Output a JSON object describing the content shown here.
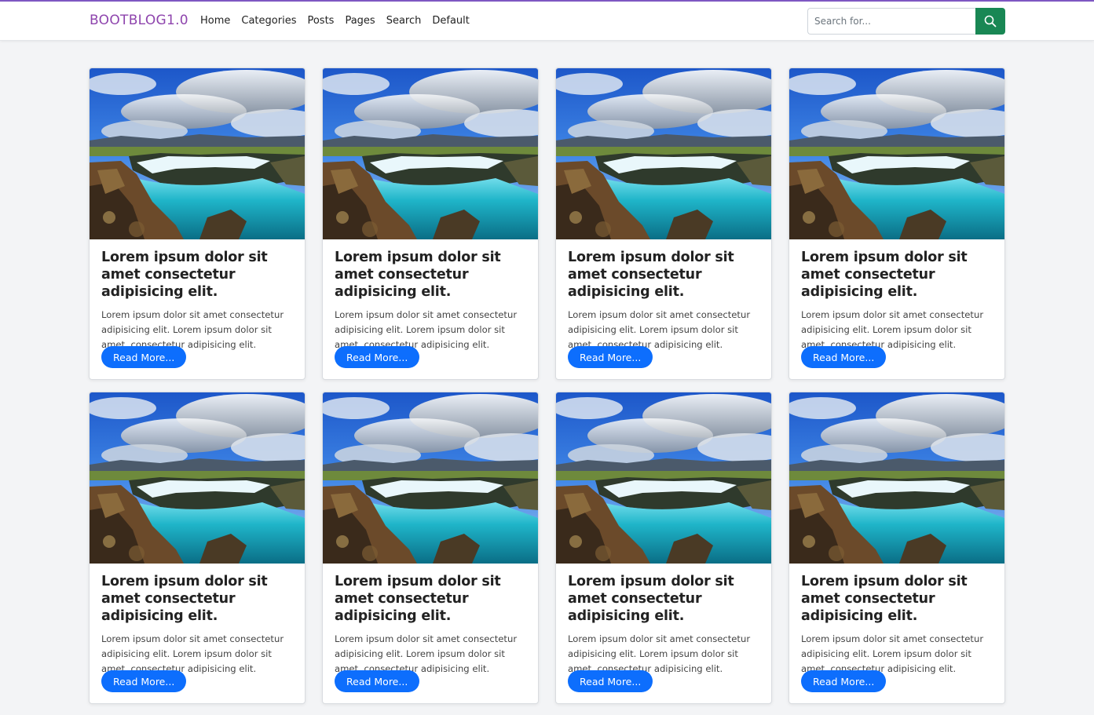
{
  "navbar": {
    "brand": "BOOTBLOG1.0",
    "links": [
      "Home",
      "Categories",
      "Posts",
      "Pages",
      "Search",
      "Default"
    ],
    "search_placeholder": "Search for...",
    "search_icon": "search-icon"
  },
  "colors": {
    "brand": "#8e44ad",
    "top_accent": "#7e57c2",
    "search_button": "#198754",
    "read_more": "#0d6efd"
  },
  "cards": [
    {
      "title": "Lorem ipsum dolor sit amet consectetur adipisicing elit.",
      "text": "Lorem ipsum dolor sit amet consectetur adipisicing elit. Lorem ipsum dolor sit amet, consectetur adipisicing elit.",
      "button": "Read More..."
    },
    {
      "title": "Lorem ipsum dolor sit amet consectetur adipisicing elit.",
      "text": "Lorem ipsum dolor sit amet consectetur adipisicing elit. Lorem ipsum dolor sit amet, consectetur adipisicing elit.",
      "button": "Read More..."
    },
    {
      "title": "Lorem ipsum dolor sit amet consectetur adipisicing elit.",
      "text": "Lorem ipsum dolor sit amet consectetur adipisicing elit. Lorem ipsum dolor sit amet, consectetur adipisicing elit.",
      "button": "Read More..."
    },
    {
      "title": "Lorem ipsum dolor sit amet consectetur adipisicing elit.",
      "text": "Lorem ipsum dolor sit amet consectetur adipisicing elit. Lorem ipsum dolor sit amet, consectetur adipisicing elit.",
      "button": "Read More..."
    },
    {
      "title": "Lorem ipsum dolor sit amet consectetur adipisicing elit.",
      "text": "Lorem ipsum dolor sit amet consectetur adipisicing elit. Lorem ipsum dolor sit amet, consectetur adipisicing elit.",
      "button": "Read More..."
    },
    {
      "title": "Lorem ipsum dolor sit amet consectetur adipisicing elit.",
      "text": "Lorem ipsum dolor sit amet consectetur adipisicing elit. Lorem ipsum dolor sit amet, consectetur adipisicing elit.",
      "button": "Read More..."
    },
    {
      "title": "Lorem ipsum dolor sit amet consectetur adipisicing elit.",
      "text": "Lorem ipsum dolor sit amet consectetur adipisicing elit. Lorem ipsum dolor sit amet, consectetur adipisicing elit.",
      "button": "Read More..."
    },
    {
      "title": "Lorem ipsum dolor sit amet consectetur adipisicing elit.",
      "text": "Lorem ipsum dolor sit amet consectetur adipisicing elit. Lorem ipsum dolor sit amet, consectetur adipisicing elit.",
      "button": "Read More..."
    }
  ]
}
